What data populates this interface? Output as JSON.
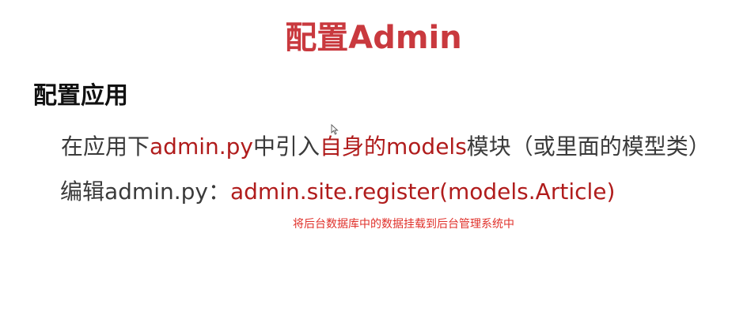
{
  "title": "配置Admin",
  "heading": "配置应用",
  "line1": {
    "part1": "在应用下",
    "part2": "admin.py",
    "part3": "中引入",
    "part4": "自身的models",
    "part5": "模块（或里面的模型类）"
  },
  "line2": {
    "part1": "编辑admin.py：",
    "part2": "admin.site.register(models.Article)"
  },
  "annotation": "将后台数据库中的数据挂载到后台管理系统中",
  "colors": {
    "title": "#c9393e",
    "highlight": "#b01c1c",
    "body_text": "#3a3a3a",
    "annotation": "#e0302a"
  },
  "icons": {
    "cursor": "mouse-pointer-icon"
  }
}
